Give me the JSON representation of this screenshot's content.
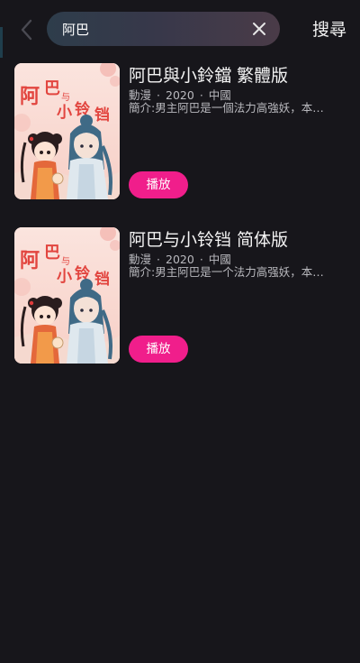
{
  "search": {
    "query": "阿巴",
    "submit_label": "搜尋",
    "back_icon": "chevron-left-icon",
    "clear_icon": "close-icon"
  },
  "colors": {
    "background": "#17161b",
    "accent": "#f01e8b",
    "secondary_text": "#b9b9be"
  },
  "results": [
    {
      "title": "阿巴與小鈴鐺 繁體版",
      "genre": "動漫",
      "year": "2020",
      "region": "中國",
      "synopsis": "簡介:男主阿巴是一個法力高強妖，本…",
      "play_label": "播放",
      "poster_text": [
        "阿",
        "巴",
        "与",
        "小",
        "铃",
        "铛"
      ]
    },
    {
      "title": "阿巴与小铃铛 简体版",
      "genre": "動漫",
      "year": "2020",
      "region": "中國",
      "synopsis": "簡介:男主阿巴是一个法力高强妖，本…",
      "play_label": "播放",
      "poster_text": [
        "阿",
        "巴",
        "与",
        "小",
        "铃",
        "铛"
      ]
    }
  ]
}
